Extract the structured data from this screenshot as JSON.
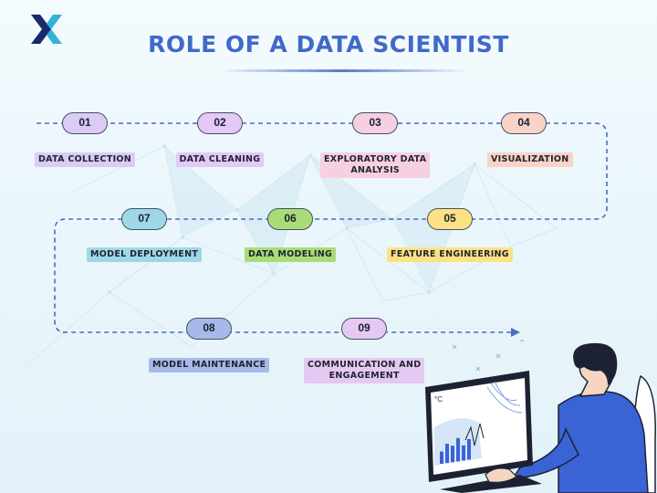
{
  "title": "ROLE OF A DATA SCIENTIST",
  "colors": {
    "title": "#4169c8",
    "connector": "#4a6bc0",
    "pill_outline": "#475066"
  },
  "steps": [
    {
      "number": "01",
      "label": "DATA COLLECTION",
      "color": "#dccbf5"
    },
    {
      "number": "02",
      "label": "DATA CLEANING",
      "color": "#e4c8f5"
    },
    {
      "number": "03",
      "label": "EXPLORATORY DATA ANALYSIS",
      "color": "#f6cfe0"
    },
    {
      "number": "04",
      "label": "VISUALIZATION",
      "color": "#f9d3c6"
    },
    {
      "number": "05",
      "label": "FEATURE ENGINEERING",
      "color": "#fde283"
    },
    {
      "number": "06",
      "label": "DATA MODELING",
      "color": "#a9dc77"
    },
    {
      "number": "07",
      "label": "MODEL DEPLOYMENT",
      "color": "#9ed8e8"
    },
    {
      "number": "08",
      "label": "MODEL MAINTENANCE",
      "color": "#a7b9ea"
    },
    {
      "number": "09",
      "label": "COMMUNICATION AND ENGAGEMENT",
      "color": "#e5c9f2"
    }
  ],
  "illustration": {
    "temperature_unit": "°C",
    "bar_levels": [
      0.45,
      0.7,
      0.6,
      0.85,
      0.55,
      0.75
    ]
  }
}
